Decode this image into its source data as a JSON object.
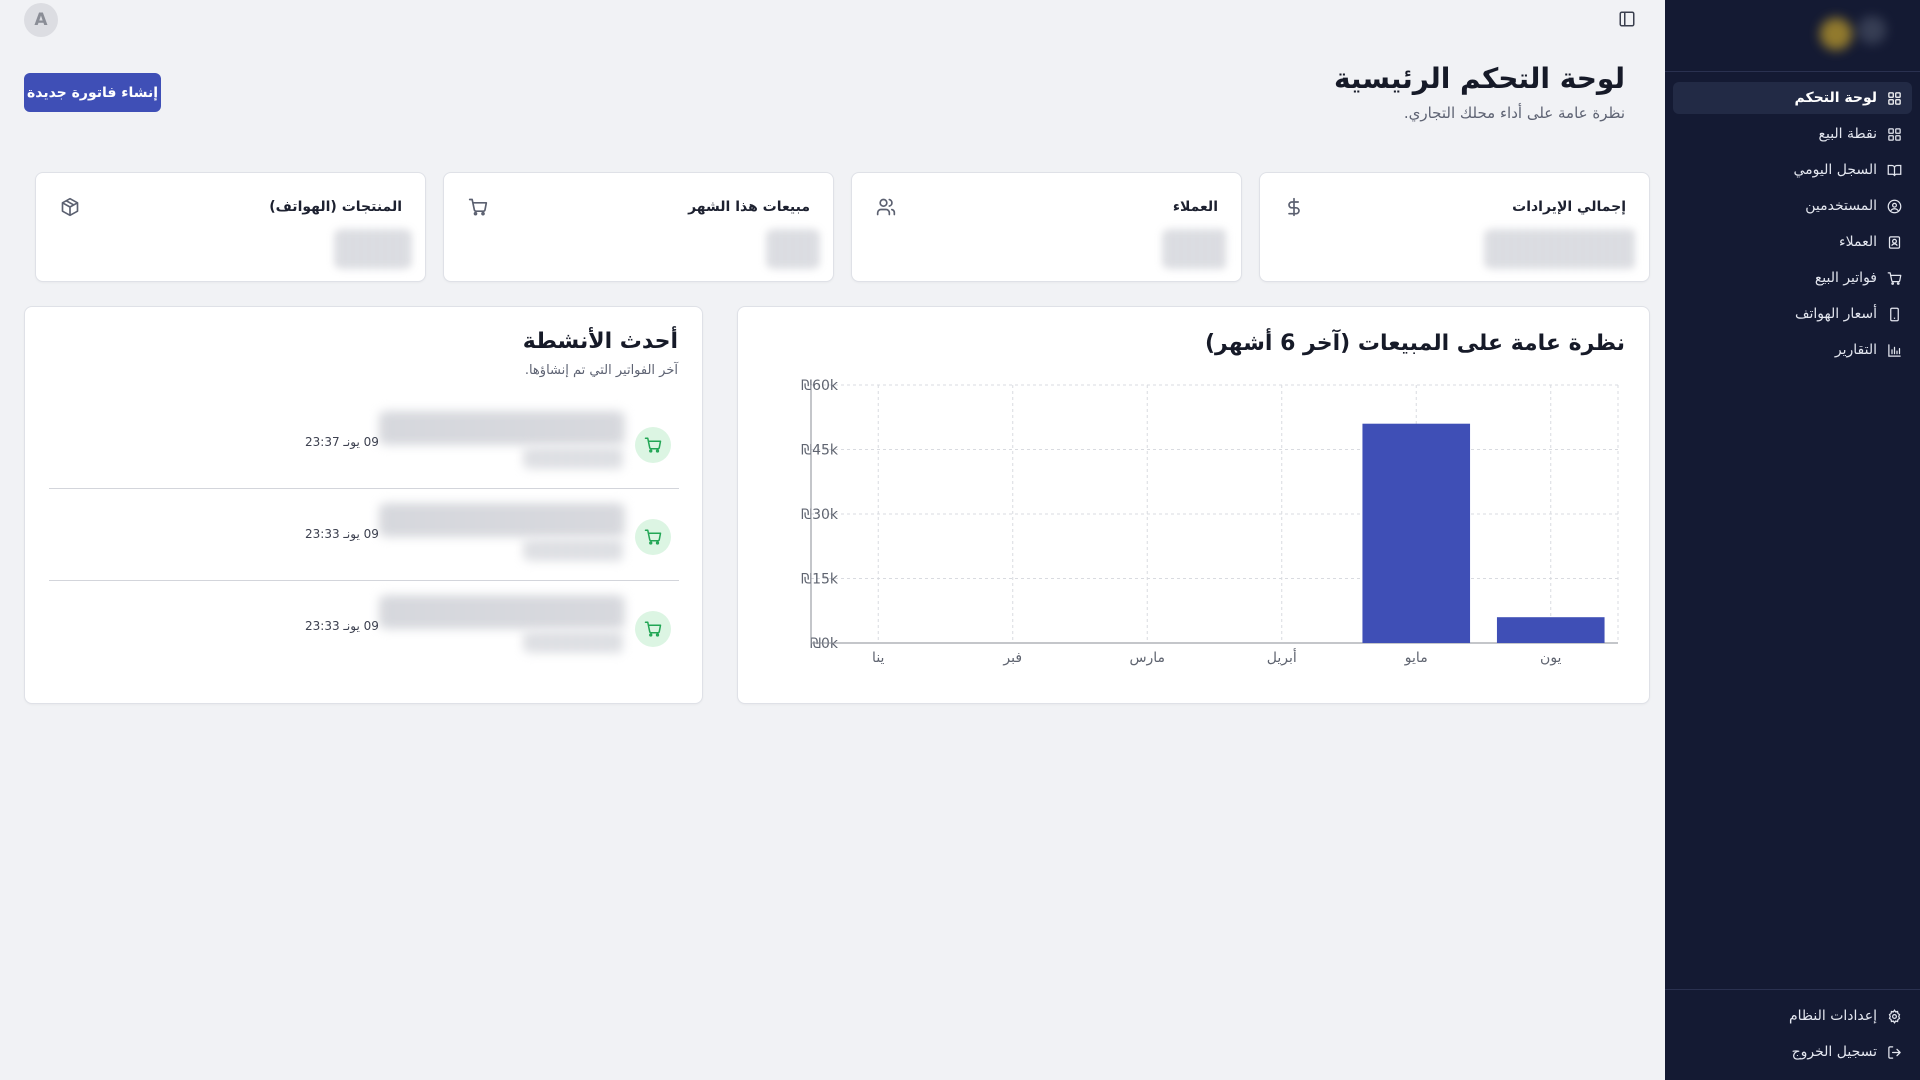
{
  "sidebar": {
    "items": [
      {
        "label": "لوحة التحكم",
        "icon": "grid-icon",
        "active": true
      },
      {
        "label": "نقطة البيع",
        "icon": "grid-icon"
      },
      {
        "label": "السجل اليومي",
        "icon": "book-icon"
      },
      {
        "label": "المستخدمين",
        "icon": "user-circle-icon"
      },
      {
        "label": "العملاء",
        "icon": "contact-icon"
      },
      {
        "label": "فواتير البيع",
        "icon": "cart-icon"
      },
      {
        "label": "أسعار الهواتف",
        "icon": "phone-icon"
      },
      {
        "label": "التقارير",
        "icon": "bar-chart-icon"
      }
    ],
    "bottom_items": [
      {
        "label": "إعدادات النظام",
        "icon": "gear-icon"
      },
      {
        "label": "تسجيل الخروج",
        "icon": "logout-icon"
      }
    ]
  },
  "topbar": {
    "avatar_letter": "A",
    "panel_toggle_icon": "panel-icon"
  },
  "header": {
    "title": "لوحة التحكم الرئيسية",
    "subtitle": "نظرة عامة على أداء محلك التجاري.",
    "new_invoice_label": "إنشاء فاتورة جديدة"
  },
  "stats": [
    {
      "label": "إجمالي الإيرادات",
      "icon": "dollar-icon"
    },
    {
      "label": "العملاء",
      "icon": "users-icon"
    },
    {
      "label": "مبيعات هذا الشهر",
      "icon": "cart-icon"
    },
    {
      "label": "المنتجات (الهواتف)",
      "icon": "package-icon"
    }
  ],
  "chart_card": {
    "title": "نظرة عامة على المبيعات (آخر 6 أشهر)"
  },
  "chart_data": {
    "type": "bar",
    "title": "نظرة عامة على المبيعات (آخر 6 أشهر)",
    "categories": [
      "ينا",
      "فبر",
      "مارس",
      "أبريل",
      "مايو",
      "يون"
    ],
    "values": [
      0,
      0,
      0,
      0,
      51000,
      6000
    ],
    "ylim": [
      0,
      60000
    ],
    "yticks": [
      0,
      15000,
      30000,
      45000,
      60000
    ],
    "ytick_labels": [
      "₪0k",
      "₪15k",
      "₪30k",
      "₪45k",
      "₪60k"
    ],
    "grid": true,
    "bar_color": "#3f4fb6"
  },
  "activity": {
    "title": "أحدث الأنشطة",
    "subtitle": "آخر الفواتير التي تم إنشاؤها.",
    "items": [
      {
        "time": "09 يونـ 23:37",
        "icon": "cart-icon"
      },
      {
        "time": "09 يونـ 23:33",
        "icon": "cart-icon"
      },
      {
        "time": "09 يونـ 23:33",
        "icon": "cart-icon"
      }
    ]
  },
  "colors": {
    "sidebar_bg": "#141a33",
    "accent": "#3f4fb6",
    "activity_icon_bg": "#dcf5e3",
    "activity_icon": "#22a655"
  }
}
